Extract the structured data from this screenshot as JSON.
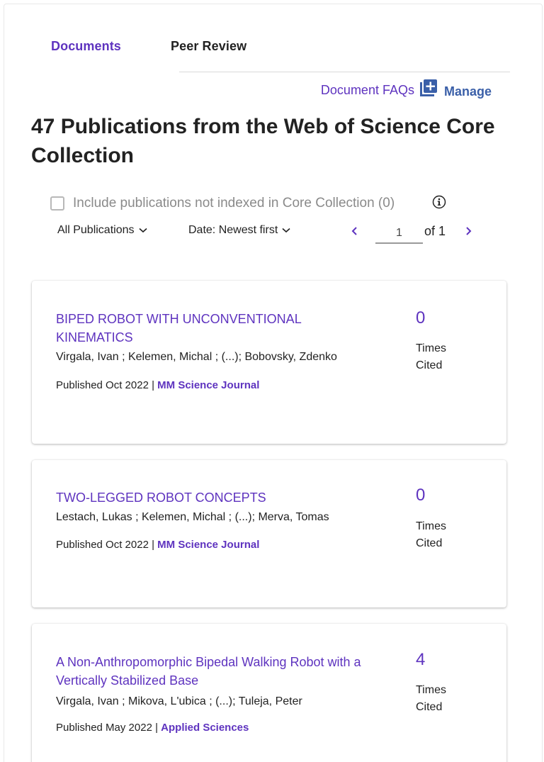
{
  "tabs": {
    "documents": "Documents",
    "peer_review": "Peer Review"
  },
  "links": {
    "faqs": "Document FAQs",
    "manage": "Manage"
  },
  "title": "47 Publications from the Web of Science Core Collection",
  "include": {
    "label": "Include publications not indexed in Core Collection (0)",
    "checked": false
  },
  "filters": {
    "publications": "All Publications",
    "sort": "Date: Newest first"
  },
  "pagination": {
    "current": "1",
    "of_text": "of 1"
  },
  "publications": [
    {
      "title": "BIPED ROBOT WITH UNCONVENTIONAL KINEMATICS",
      "authors": "Virgala, Ivan ; Kelemen, Michal ; (...); Bobovsky, Zdenko",
      "published": "Published Oct 2022 | ",
      "journal": "MM Science Journal",
      "times_cited": "0",
      "times_cited_label": "Times Cited"
    },
    {
      "title": "TWO-LEGGED ROBOT CONCEPTS",
      "authors": "Lestach, Lukas ; Kelemen, Michal ; (...); Merva, Tomas",
      "published": "Published Oct 2022 | ",
      "journal": "MM Science Journal",
      "times_cited": "0",
      "times_cited_label": "Times Cited"
    },
    {
      "title": "A Non-Anthropomorphic Bipedal Walking Robot with a Vertically Stabilized Base",
      "authors": "Virgala, Ivan ; Mikova, L'ubica ; (...); Tuleja, Peter",
      "published": "Published May 2022 | ",
      "journal": "Applied Sciences",
      "times_cited": "4",
      "times_cited_label": "Times Cited"
    }
  ],
  "colors": {
    "accent": "#5e33bf",
    "manage": "#3a5fa8",
    "text": "#222222",
    "muted": "#8a8a8a"
  },
  "icons": {
    "manage": "add-box-icon",
    "info": "info-icon",
    "dropdown": "chevron-down-icon",
    "prev": "chevron-left-icon",
    "next": "chevron-right-icon"
  }
}
